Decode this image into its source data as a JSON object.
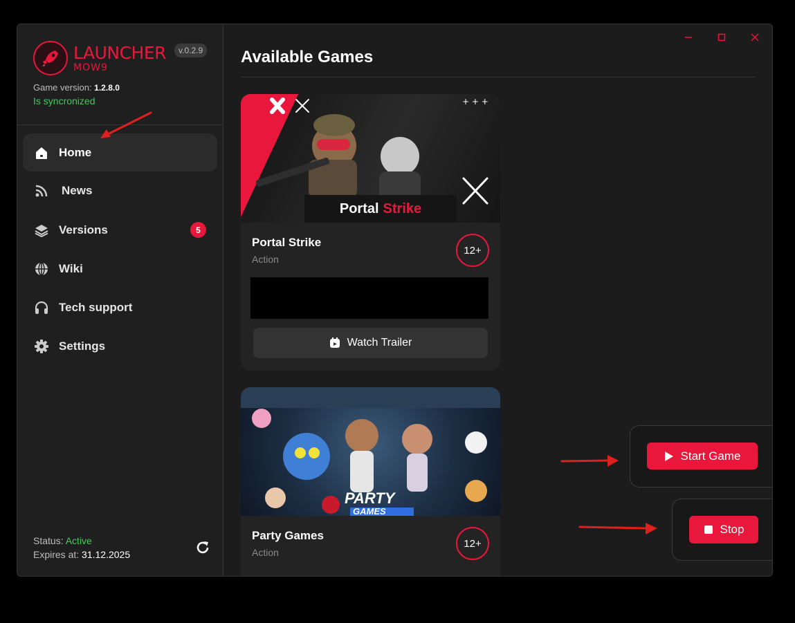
{
  "app": {
    "title": "LAUNCHER",
    "subtitle": "MOW9",
    "version": "v.0.2.9",
    "game_version_label": "Game version:",
    "game_version_value": "1.2.8.0",
    "sync_status": "Is syncronized"
  },
  "sidebar": {
    "items": [
      {
        "label": "Home",
        "icon": "home-icon",
        "active": true
      },
      {
        "label": "News",
        "icon": "rss-icon"
      },
      {
        "label": "Versions",
        "icon": "layers-icon",
        "badge": "5"
      },
      {
        "label": "Wiki",
        "icon": "globe-icon"
      },
      {
        "label": "Tech support",
        "icon": "headphones-icon"
      },
      {
        "label": "Settings",
        "icon": "gear-icon"
      }
    ],
    "status_label": "Status:",
    "status_value": "Active",
    "expires_label": "Expires at:",
    "expires_value": "31.12.2025"
  },
  "main": {
    "title": "Available Games",
    "games": [
      {
        "title": "Portal Strike",
        "genre": "Action",
        "age": "12+",
        "art_title_a": "Portal",
        "art_title_b": "Strike",
        "trailer_label": "Watch Trailer"
      },
      {
        "title": "Party Games",
        "genre": "Action",
        "age": "12+",
        "art_title_a": "PARTY",
        "art_title_b": "GAMES"
      }
    ]
  },
  "actions": {
    "start_label": "Start Game",
    "stop_label": "Stop"
  },
  "colors": {
    "accent": "#e8173b",
    "success": "#47c75d",
    "background": "#1c1c1c",
    "annotation_arrow": "#e0201f"
  }
}
